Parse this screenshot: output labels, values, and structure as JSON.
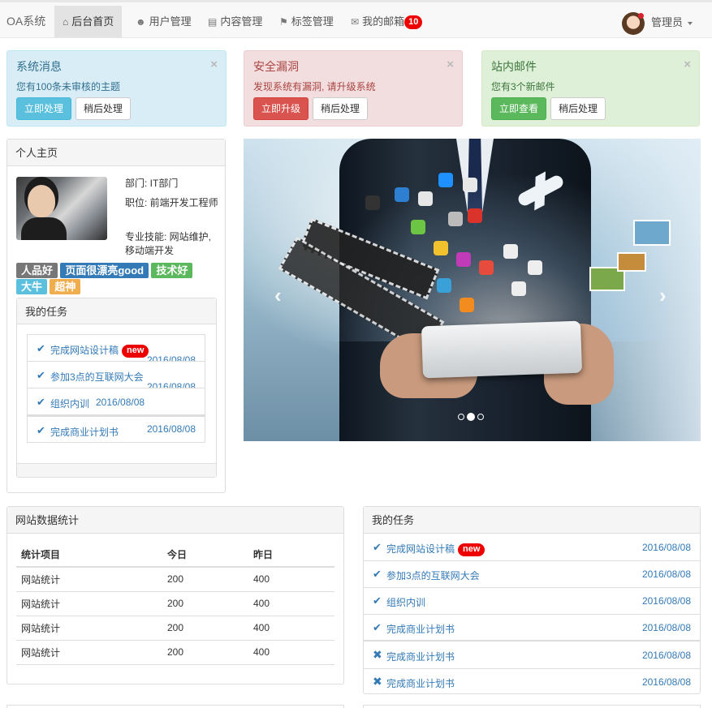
{
  "navbar": {
    "brand": "OA系统",
    "items": [
      {
        "label": "后台首页",
        "icon": "home-icon"
      },
      {
        "label": "用户管理",
        "icon": "user-icon"
      },
      {
        "label": "内容管理",
        "icon": "list-icon"
      },
      {
        "label": "标签管理",
        "icon": "tags-icon"
      },
      {
        "label": "我的邮箱",
        "icon": "envelope-icon",
        "badge": "10"
      }
    ],
    "user": "管理员"
  },
  "alerts": [
    {
      "title": "系统消息",
      "text": "您有100条未审核的主题",
      "primary": "立即处理",
      "secondary": "稍后处理"
    },
    {
      "title": "安全漏洞",
      "text": "发现系统有漏洞, 请升级系统",
      "primary": "立即升级",
      "secondary": "稍后处理"
    },
    {
      "title": "站内邮件",
      "text": "您有3个新邮件",
      "primary": "立即查看",
      "secondary": "稍后处理"
    }
  ],
  "profile": {
    "title": "个人主页",
    "department": "部门: IT部门",
    "position": "职位: 前端开发工程师",
    "skills": "专业技能: 网站维护, 移动端开发",
    "tags": [
      "人品好",
      "页面很漂亮good",
      "技术好",
      "大牛",
      "超神"
    ],
    "tasks_title": "我的任务",
    "tasks": [
      {
        "label": "完成网站设计稿",
        "badge": "new",
        "date": "2016/08/08"
      },
      {
        "label": "参加3点的互联网大会",
        "date": "2016/08/08"
      },
      {
        "label": "组织内训",
        "date": "2016/08/08"
      },
      {
        "label": "完成商业计划书",
        "date": "2016/08/08"
      }
    ]
  },
  "carousel": {
    "prev": "‹",
    "next": "›",
    "slides": 3,
    "active": 1
  },
  "stats": {
    "title": "网站数据统计",
    "headers": [
      "统计项目",
      "今日",
      "昨日"
    ],
    "rows": [
      [
        "网站统计",
        "200",
        "400"
      ],
      [
        "网站统计",
        "200",
        "400"
      ],
      [
        "网站统计",
        "200",
        "400"
      ],
      [
        "网站统计",
        "200",
        "400"
      ]
    ]
  },
  "tasks": {
    "title": "我的任务",
    "items": [
      {
        "label": "完成网站设计稿",
        "badge": "new",
        "date": "2016/08/08",
        "icon": "check-icon"
      },
      {
        "label": "参加3点的互联网大会",
        "date": "2016/08/08",
        "icon": "check-icon"
      },
      {
        "label": "组织内训",
        "date": "2016/08/08",
        "icon": "check-icon"
      },
      {
        "label": "完成商业计划书",
        "date": "2016/08/08",
        "icon": "check-icon"
      },
      {
        "label": "完成商业计划书",
        "date": "2016/08/08",
        "icon": "remove-icon"
      },
      {
        "label": "完成商业计划书",
        "date": "2016/08/08",
        "icon": "remove-icon"
      }
    ]
  }
}
